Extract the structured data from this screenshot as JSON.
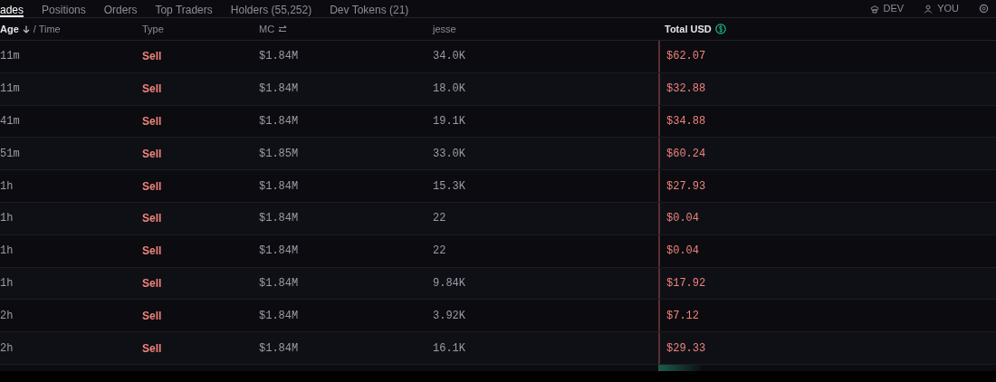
{
  "tabs": [
    {
      "label": "ades",
      "selected": true
    },
    {
      "label": "Positions",
      "selected": false
    },
    {
      "label": "Orders",
      "selected": false
    },
    {
      "label": "Top Traders",
      "selected": false
    },
    {
      "label": "Holders (55,252)",
      "selected": false
    },
    {
      "label": "Dev Tokens (21)",
      "selected": false
    }
  ],
  "filters": [
    {
      "label": "DEV",
      "kind": "dev"
    },
    {
      "label": "YOU",
      "kind": "you"
    }
  ],
  "table": {
    "columns": [
      {
        "label": "Age",
        "sort_descending": true,
        "suffix": "/ Time"
      },
      {
        "label": "Type"
      },
      {
        "label": "MC"
      },
      {
        "label": "jesse"
      },
      {
        "label": "Total USD"
      }
    ],
    "rows": [
      {
        "age": "11m",
        "type": "Sell",
        "kind": "sell",
        "mc": "$1.84M",
        "amount": "34.0K",
        "total": "$62.07"
      },
      {
        "age": "11m",
        "type": "Sell",
        "kind": "sell",
        "mc": "$1.84M",
        "amount": "18.0K",
        "total": "$32.88"
      },
      {
        "age": "41m",
        "type": "Sell",
        "kind": "sell",
        "mc": "$1.84M",
        "amount": "19.1K",
        "total": "$34.88"
      },
      {
        "age": "51m",
        "type": "Sell",
        "kind": "sell",
        "mc": "$1.85M",
        "amount": "33.0K",
        "total": "$60.24"
      },
      {
        "age": "1h",
        "type": "Sell",
        "kind": "sell",
        "mc": "$1.84M",
        "amount": "15.3K",
        "total": "$27.93"
      },
      {
        "age": "1h",
        "type": "Sell",
        "kind": "sell",
        "mc": "$1.84M",
        "amount": "22",
        "total": "$0.04"
      },
      {
        "age": "1h",
        "type": "Sell",
        "kind": "sell",
        "mc": "$1.84M",
        "amount": "22",
        "total": "$0.04"
      },
      {
        "age": "1h",
        "type": "Sell",
        "kind": "sell",
        "mc": "$1.84M",
        "amount": "9.84K",
        "total": "$17.92"
      },
      {
        "age": "2h",
        "type": "Sell",
        "kind": "sell",
        "mc": "$1.84M",
        "amount": "3.92K",
        "total": "$7.12"
      },
      {
        "age": "2h",
        "type": "Sell",
        "kind": "sell",
        "mc": "$1.84M",
        "amount": "16.1K",
        "total": "$29.33"
      }
    ]
  }
}
